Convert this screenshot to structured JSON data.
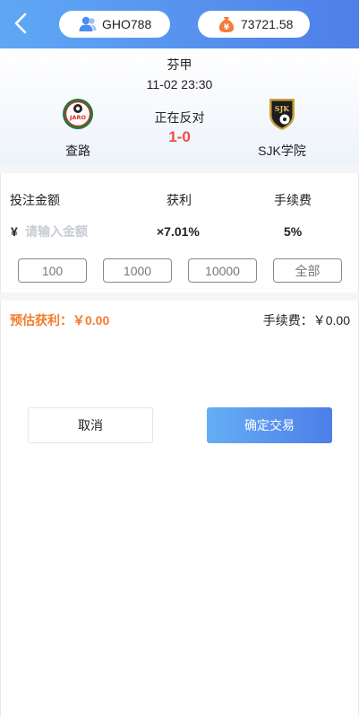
{
  "header": {
    "username": "GHO788",
    "balance": "73721.58"
  },
  "match": {
    "league": "芬甲",
    "time": "11-02 23:30",
    "status": "正在反对",
    "score": "1-0",
    "home_team": "查路",
    "home_logo_text": "JARO",
    "away_team": "SJK学院",
    "away_logo_text": "SJK"
  },
  "bet": {
    "amount_label": "投注金额",
    "profit_label": "获利",
    "fee_label": "手续费",
    "currency_symbol": "¥",
    "amount_placeholder": "请输入金额",
    "profit_value": "×7.01%",
    "fee_value": "5%",
    "quick_amounts": [
      "100",
      "1000",
      "10000",
      "全部"
    ]
  },
  "summary": {
    "estimated_profit": "预估获利：￥0.00",
    "fee_total": "手续费：￥0.00"
  },
  "actions": {
    "cancel_label": "取消",
    "confirm_label": "确定交易"
  },
  "colors": {
    "header_gradient_start": "#5fa8f5",
    "header_gradient_end": "#4f7fe8",
    "score_red": "#f14b4b",
    "profit_orange": "#f47b2b",
    "wallet_icon_orange": "#f37a3c",
    "user_icon_blue": "#4a8ef0"
  },
  "icons": {
    "back": "back-arrow-icon",
    "user": "user-icon",
    "wallet": "wallet-icon"
  }
}
